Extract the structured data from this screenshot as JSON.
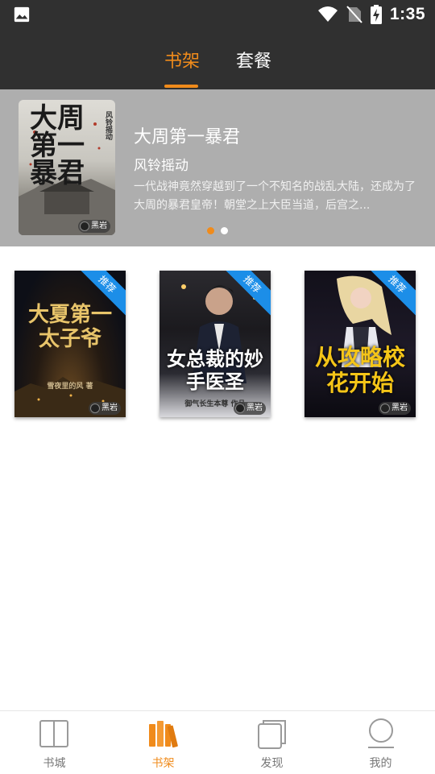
{
  "status_bar": {
    "time": "1:35",
    "icons": [
      "image-icon",
      "wifi-icon",
      "no-sim-icon",
      "battery-charging-icon"
    ]
  },
  "top_tabs": [
    {
      "label": "书架",
      "active": true
    },
    {
      "label": "套餐",
      "active": false
    }
  ],
  "banner": {
    "title": "大周第一暴君",
    "author": "风铃摇动",
    "description": "一代战神竟然穿越到了一个不知名的战乱大陆，还成为了大周的暴君皇帝！朝堂之上大臣当道，后宫之...",
    "cover_title_art": "大周第一暴君",
    "cover_author_art": "风铃摇动",
    "publisher": "黑岩",
    "dots": [
      true,
      false
    ]
  },
  "books": [
    {
      "title_art": "大夏第一太子爷",
      "author_art": "雪夜里的风 著",
      "badge": "推荐",
      "publisher": "黑岩"
    },
    {
      "title_art": "女总裁的妙手医圣",
      "author_art": "御气长生本尊 作品",
      "badge": "推荐",
      "publisher": "黑岩"
    },
    {
      "title_art": "从攻略校花开始",
      "author_art": "",
      "badge": "推荐",
      "publisher": "黑岩"
    }
  ],
  "bottom_nav": [
    {
      "label": "书城",
      "icon": "book-open-icon",
      "active": false
    },
    {
      "label": "书架",
      "icon": "bookshelf-icon",
      "active": true
    },
    {
      "label": "发现",
      "icon": "discover-icon",
      "active": false
    },
    {
      "label": "我的",
      "icon": "profile-icon",
      "active": false
    }
  ],
  "colors": {
    "accent": "#f08b1b",
    "header_bg": "#303030",
    "banner_bg": "#aeaeae",
    "badge_blue": "#1c8ee8"
  }
}
